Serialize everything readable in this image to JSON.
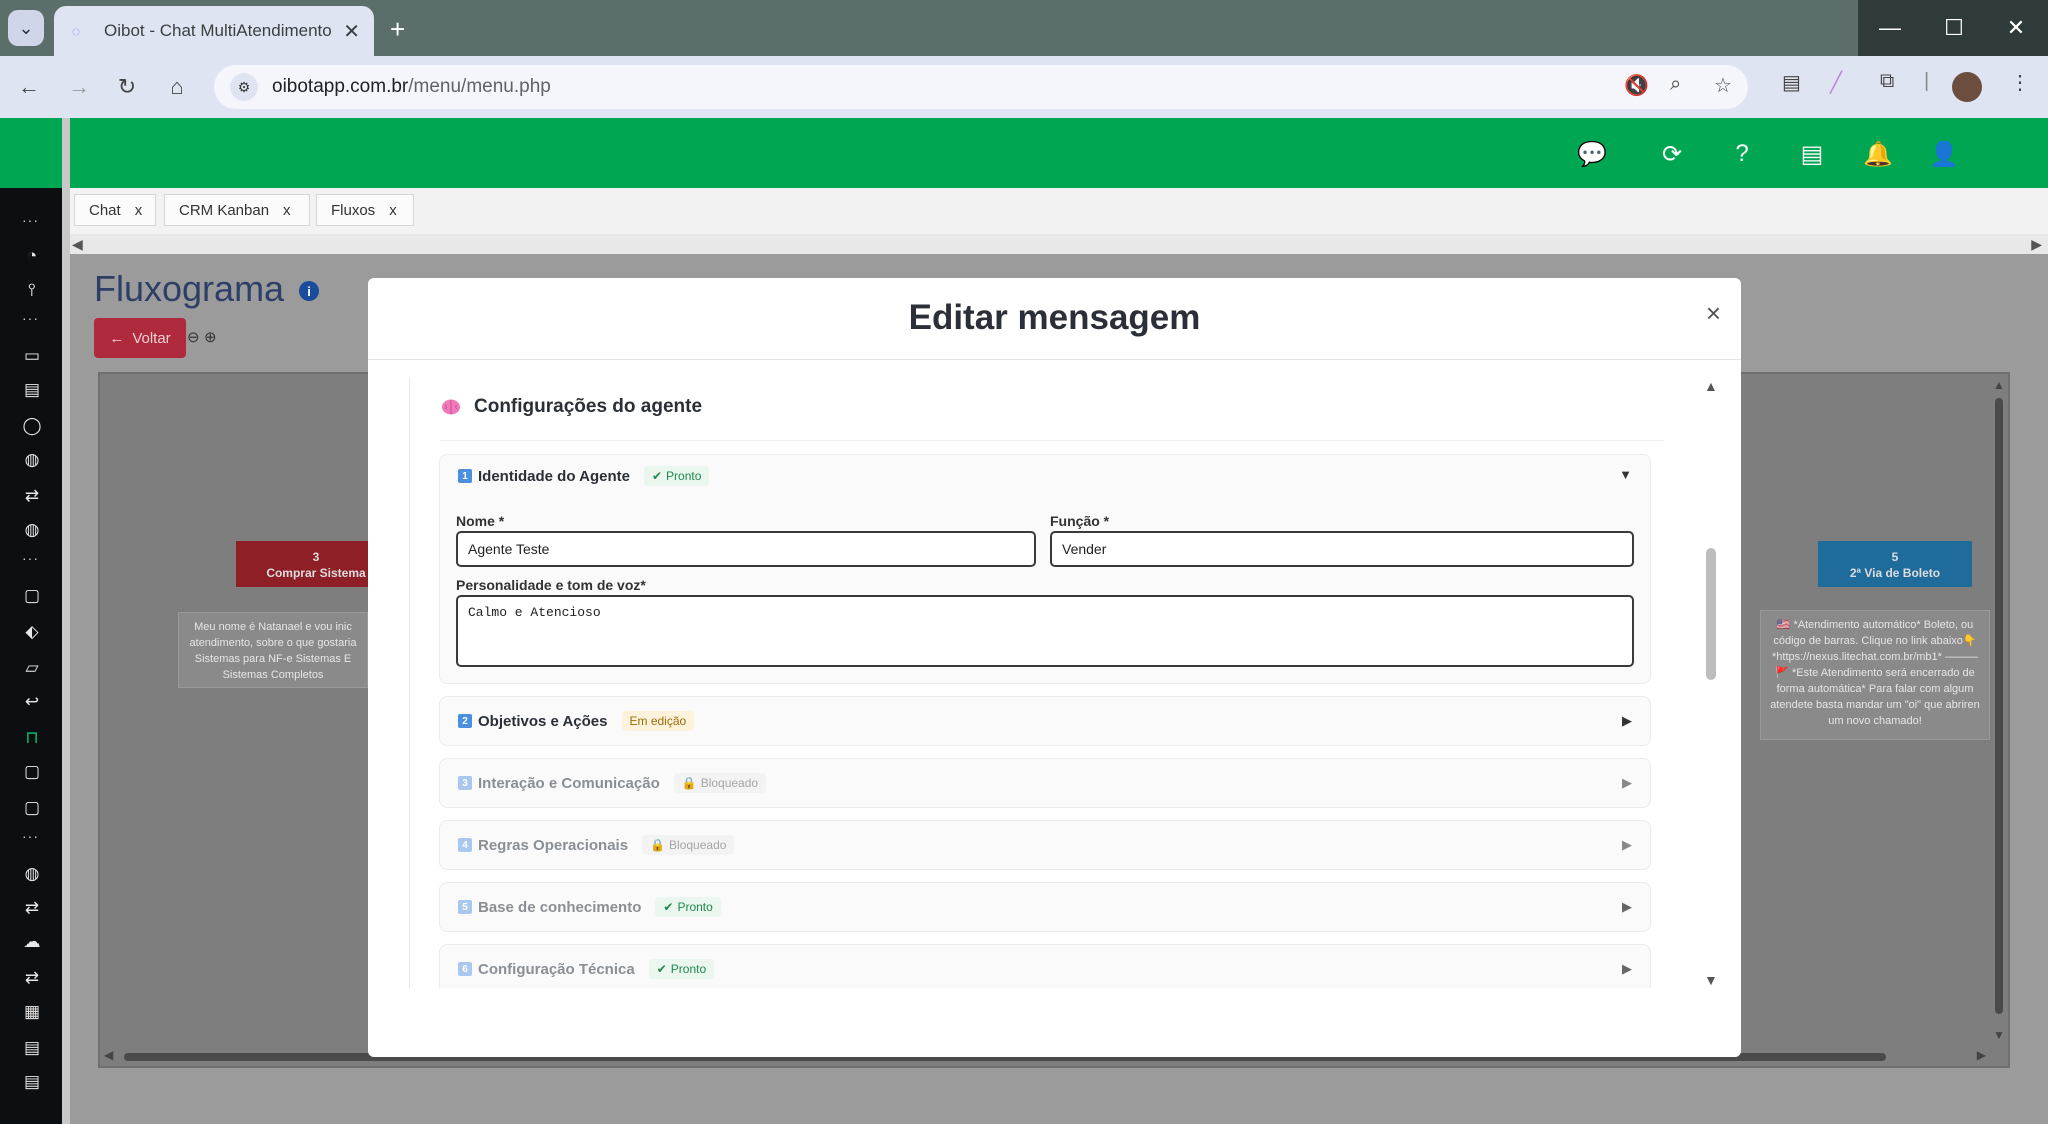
{
  "browser": {
    "tab_title": "Oibot - Chat MultiAtendimento",
    "url_domain": "oibotapp.com.br",
    "url_path": "/menu/menu.php"
  },
  "app": {
    "tabs": [
      {
        "label": "Chat",
        "close": "x"
      },
      {
        "label": "CRM Kanban",
        "close": "x"
      },
      {
        "label": "Fluxos",
        "close": "x"
      }
    ],
    "page_title": "Fluxograma",
    "info_glyph": "i",
    "back_label": "Voltar",
    "brand_color": "#00a651"
  },
  "flow": {
    "node_red": {
      "number": "3",
      "label": "Comprar Sistema"
    },
    "node_blue": {
      "number": "5",
      "label": "2ª Via de Boleto"
    },
    "note_left": "Meu nome é Natanael e vou inic atendimento, sobre o que gostaria Sistemas para NF-e Sistemas E Sistemas Completos",
    "note_right": "🇺🇸 *Atendimento automático* Boleto, ou código de barras. Clique no link abaixo👇 *https://nexus.litechat.com.br/mb1* ——— 🚩 *Este Atendimento será encerrado de forma automática* Para falar com algum atendete basta mandar um \"oi\" que abriren um novo chamado!"
  },
  "modal": {
    "title": "Editar mensagem",
    "close": "×",
    "section_title": "Configurações do agente",
    "cards": [
      {
        "num": "1",
        "title": "Identidade do Agente",
        "status": "Pronto",
        "state": "ok",
        "caret": "▼"
      },
      {
        "num": "2",
        "title": "Objetivos e Ações",
        "status": "Em edição",
        "state": "edit",
        "caret": "▶"
      },
      {
        "num": "3",
        "title": "Interação e Comunicação",
        "status": "Bloqueado",
        "state": "lock",
        "caret": "▶"
      },
      {
        "num": "4",
        "title": "Regras Operacionais",
        "status": "Bloqueado",
        "state": "lock",
        "caret": "▶"
      },
      {
        "num": "5",
        "title": "Base de conhecimento",
        "status": "Pronto",
        "state": "ok",
        "caret": "▶"
      },
      {
        "num": "6",
        "title": "Configuração Técnica",
        "status": "Pronto",
        "state": "ok",
        "caret": "▶"
      }
    ],
    "form": {
      "nome_label": "Nome *",
      "nome_value": "Agente Teste",
      "funcao_label": "Função *",
      "funcao_value": "Vender",
      "personalidade_label": "Personalidade e tom de voz*",
      "personalidade_value": "Calmo e Atencioso"
    }
  }
}
